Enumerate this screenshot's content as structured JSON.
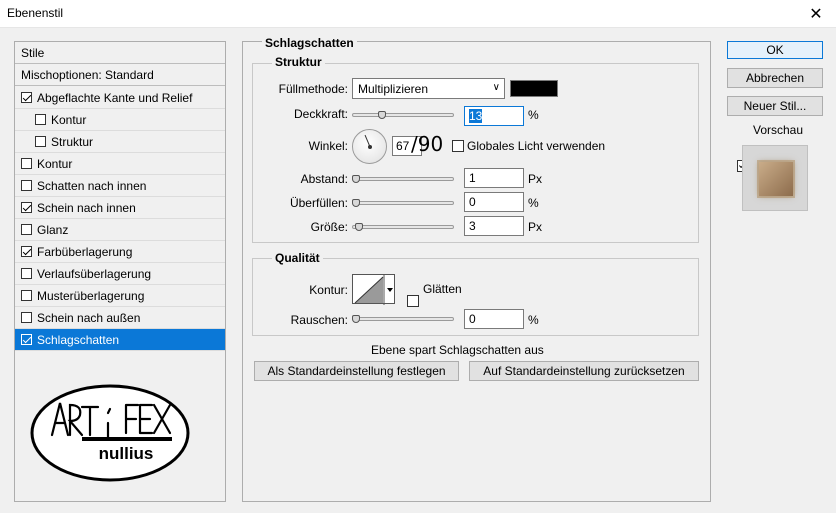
{
  "window": {
    "title": "Ebenenstil",
    "close_glyph": "✕"
  },
  "sidebar": {
    "header": "Stile",
    "blend_options": "Mischoptionen: Standard",
    "items": [
      {
        "label": "Abgeflachte Kante und Relief",
        "checked": true
      },
      {
        "label": "Kontur",
        "checked": false,
        "sub": true
      },
      {
        "label": "Struktur",
        "checked": false,
        "sub": true
      },
      {
        "label": "Kontur",
        "checked": false
      },
      {
        "label": "Schatten nach innen",
        "checked": false
      },
      {
        "label": "Schein nach innen",
        "checked": true
      },
      {
        "label": "Glanz",
        "checked": false
      },
      {
        "label": "Farbüberlagerung",
        "checked": true
      },
      {
        "label": "Verlaufsüberlagerung",
        "checked": false
      },
      {
        "label": "Musterüberlagerung",
        "checked": false
      },
      {
        "label": "Schein nach außen",
        "checked": false
      },
      {
        "label": "Schlagschatten",
        "checked": true,
        "selected": true
      }
    ],
    "logo": {
      "top_text": "ART I FEX",
      "bottom_text": "nullius"
    }
  },
  "panel": {
    "title": "Schlagschatten",
    "structure": {
      "title": "Struktur",
      "blend_mode_label": "Füllmethode:",
      "blend_mode_value": "Multiplizieren",
      "color": "#000000",
      "opacity_label": "Deckkraft:",
      "opacity_value": "13",
      "opacity_unit": "%",
      "angle_label": "Winkel:",
      "angle_value": "67",
      "angle_overlay": "/90",
      "global_light_label": "Globales Licht verwenden",
      "global_light_checked": false,
      "distance_label": "Abstand:",
      "distance_value": "1",
      "distance_unit": "Px",
      "spread_label": "Überfüllen:",
      "spread_value": "0",
      "spread_unit": "%",
      "size_label": "Größe:",
      "size_value": "3",
      "size_unit": "Px"
    },
    "quality": {
      "title": "Qualität",
      "contour_label": "Kontur:",
      "antialias_label": "Glätten",
      "antialias_checked": false,
      "noise_label": "Rauschen:",
      "noise_value": "0",
      "noise_unit": "%"
    },
    "knockout_label": "Ebene spart Schlagschatten aus",
    "knockout_checked": true,
    "make_default_label": "Als Standardeinstellung festlegen",
    "reset_default_label": "Auf Standardeinstellung zurücksetzen"
  },
  "actions": {
    "ok_label": "OK",
    "cancel_label": "Abbrechen",
    "new_style_label": "Neuer Stil...",
    "preview_label": "Vorschau",
    "preview_checked": true
  }
}
